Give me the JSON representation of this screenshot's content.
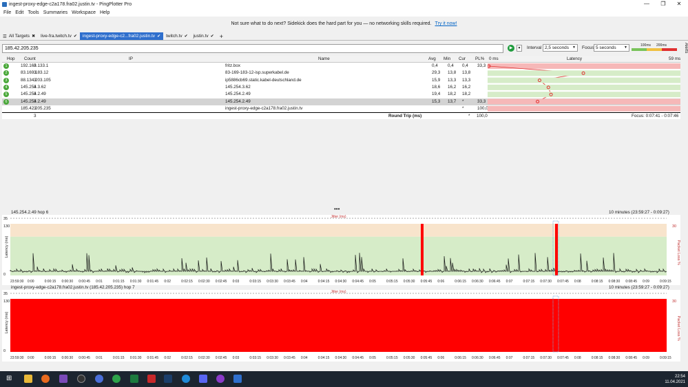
{
  "window": {
    "title": "ingest-proxy-edge-c2a178.fra02.justin.tv - PingPlotter Pro"
  },
  "menu": [
    "File",
    "Edit",
    "Tools",
    "Summaries",
    "Workspace",
    "Help"
  ],
  "banner": {
    "text": "Not sure what to do next? Sidekick does the hard part for you — no networking skills required.",
    "link": "Try it now!"
  },
  "tabs": [
    {
      "label": "All Targets",
      "icon": "x"
    },
    {
      "label": "live-fra.twitch.tv",
      "icon": "check"
    },
    {
      "label": "ingest-proxy-edge-c2...fra02.justin.tv",
      "icon": "check",
      "active": true
    },
    {
      "label": "twitch.tv",
      "icon": "check"
    },
    {
      "label": "justin.tv",
      "icon": "check"
    }
  ],
  "toolbar": {
    "target": "185.42.205.235",
    "interval_label": "Interval",
    "interval_value": "2,5 seconds",
    "focus_label": "Focus",
    "focus_value": "5 seconds",
    "scale_100": "100ms",
    "scale_200": "200ms",
    "alerts_label": "Alerts"
  },
  "table": {
    "headers": {
      "hop": "Hop",
      "count": "Count",
      "ip": "IP",
      "name": "Name",
      "avg": "Avg",
      "min": "Min",
      "cur": "Cur",
      "pl": "PL%",
      "zero": "0 ms",
      "latency": "Latency",
      "max": "59 ms"
    },
    "rows": [
      {
        "hop": "1",
        "count": "3",
        "ip": "192.168.133.1",
        "name": "fritz.box",
        "avg": "0,4",
        "min": "0,4",
        "cur": "0,4",
        "pl": "33,3"
      },
      {
        "hop": "2",
        "count": "3",
        "ip": "83.169.183.12",
        "name": "83-169-183-12-isp.superkabel.de",
        "avg": "29,3",
        "min": "13,8",
        "cur": "13,8",
        "pl": ""
      },
      {
        "hop": "3",
        "count": "3",
        "ip": "88.134.203.105",
        "name": "ip5886cb69.static.kabel-deutschland.de",
        "avg": "15,9",
        "min": "13,3",
        "cur": "13,3",
        "pl": ""
      },
      {
        "hop": "4",
        "count": "3",
        "ip": "145.254.3.62",
        "name": "145.254.3.62",
        "avg": "18,6",
        "min": "16,2",
        "cur": "16,2",
        "pl": ""
      },
      {
        "hop": "5",
        "count": "3",
        "ip": "145.254.2.49",
        "name": "145.254.2.49",
        "avg": "19,4",
        "min": "18,2",
        "cur": "18,2",
        "pl": ""
      },
      {
        "hop": "6",
        "count": "3",
        "ip": "145.254.2.49",
        "name": "145.254.2.49",
        "avg": "15,3",
        "min": "13,7",
        "cur": "*",
        "pl": "33,3"
      },
      {
        "hop": "",
        "count": "3",
        "ip": "185.42.205.235",
        "name": "ingest-proxy-edge-c2a178.fra02.justin.tv",
        "avg": "",
        "min": "",
        "cur": "*",
        "pl": "100,0"
      }
    ],
    "footer": {
      "count": "3",
      "label": "Round Trip (ms)",
      "cur": "*",
      "pl": "100,0",
      "focus": "Focus: 0:07:41 - 0:07:46"
    },
    "latency_points_ms": [
      0.4,
      29.3,
      15.9,
      18.6,
      19.4,
      15.3
    ]
  },
  "graph1": {
    "title": "145.254.2.49 hop 6",
    "range": "10 minutes (23:59:27 - 0:09:27)",
    "jitter": "Jitter (ms)",
    "y_max": "130",
    "y_mid": "35",
    "y_zero": "0",
    "ylabel": "Latency (ms)",
    "y2label": "Packet Loss %",
    "y2_max": "30"
  },
  "graph2": {
    "title": "ingest-proxy-edge-c2a178.fra02.justin.tv (185.42.205.235) hop 7",
    "range": "10 minutes (23:59:27 - 0:09:27)",
    "jitter": "Jitter (ms)",
    "y_max": "130",
    "y_mid": "35",
    "y_zero": "0",
    "ylabel": "Latency (ms)",
    "y2label": "Packet Loss %",
    "y2_max": "30"
  },
  "time_ticks": [
    "23:59:30",
    "0:00",
    "0:00:15",
    "0:00:30",
    "0:00:45",
    "0:01",
    "0:01:15",
    "0:01:30",
    "0:01:45",
    "0:02",
    "0:02:15",
    "0:02:30",
    "0:02:45",
    "0:03",
    "0:03:15",
    "0:03:30",
    "0:03:45",
    "0:04",
    "0:04:15",
    "0:04:30",
    "0:04:45",
    "0:05",
    "0:05:15",
    "0:05:30",
    "0:05:45",
    "0:06",
    "0:06:15",
    "0:06:30",
    "0:06:45",
    "0:07",
    "0:07:15",
    "0:07:30",
    "0:07:45",
    "0:08",
    "0:08:15",
    "0:08:30",
    "0:08:45",
    "0:09",
    "0:09:15"
  ],
  "clock": {
    "time": "22:54",
    "date": "11.04.2021"
  },
  "colors": {
    "accent": "#2f6fcd",
    "loss": "#ff0000",
    "good": "#d6ecc8",
    "warn": "#f8e4cc",
    "bad": "#f6b8b8"
  }
}
